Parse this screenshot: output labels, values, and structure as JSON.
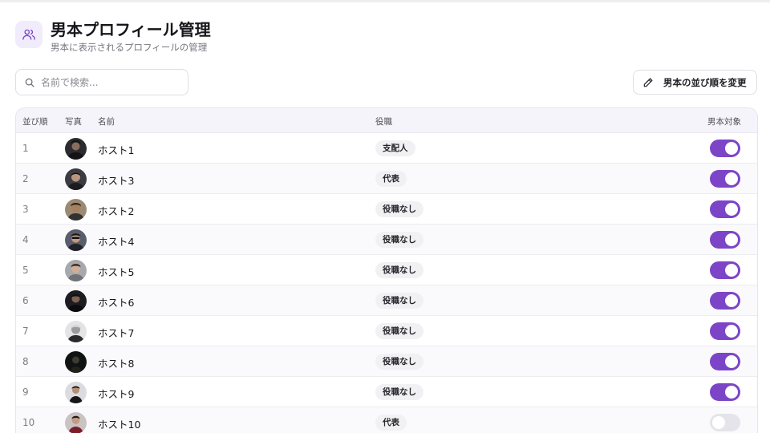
{
  "header": {
    "title": "男本プロフィール管理",
    "subtitle": "男本に表示されるプロフィールの管理",
    "icon": "users-icon"
  },
  "search": {
    "placeholder": "名前で検索...",
    "value": ""
  },
  "toolbar": {
    "reorder_label": "男本の並び順を変更"
  },
  "table": {
    "columns": {
      "order": "並び順",
      "photo": "写真",
      "name": "名前",
      "role": "役職",
      "featured": "男本対象"
    },
    "rows": [
      {
        "order": "1",
        "name": "ホスト1",
        "role": "支配人",
        "featured": true
      },
      {
        "order": "2",
        "name": "ホスト3",
        "role": "代表",
        "featured": true
      },
      {
        "order": "3",
        "name": "ホスト2",
        "role": "役職なし",
        "featured": true
      },
      {
        "order": "4",
        "name": "ホスト4",
        "role": "役職なし",
        "featured": true
      },
      {
        "order": "5",
        "name": "ホスト5",
        "role": "役職なし",
        "featured": true
      },
      {
        "order": "6",
        "name": "ホスト6",
        "role": "役職なし",
        "featured": true
      },
      {
        "order": "7",
        "name": "ホスト7",
        "role": "役職なし",
        "featured": true
      },
      {
        "order": "8",
        "name": "ホスト8",
        "role": "役職なし",
        "featured": true
      },
      {
        "order": "9",
        "name": "ホスト9",
        "role": "役職なし",
        "featured": true
      },
      {
        "order": "10",
        "name": "ホスト10",
        "role": "代表",
        "featured": false
      }
    ]
  },
  "colors": {
    "accent": "#7c45c8",
    "toggle_off": "#e4e4ea",
    "header_icon_bg": "#f1ecfb",
    "table_header_bg": "#f6f4fb"
  }
}
